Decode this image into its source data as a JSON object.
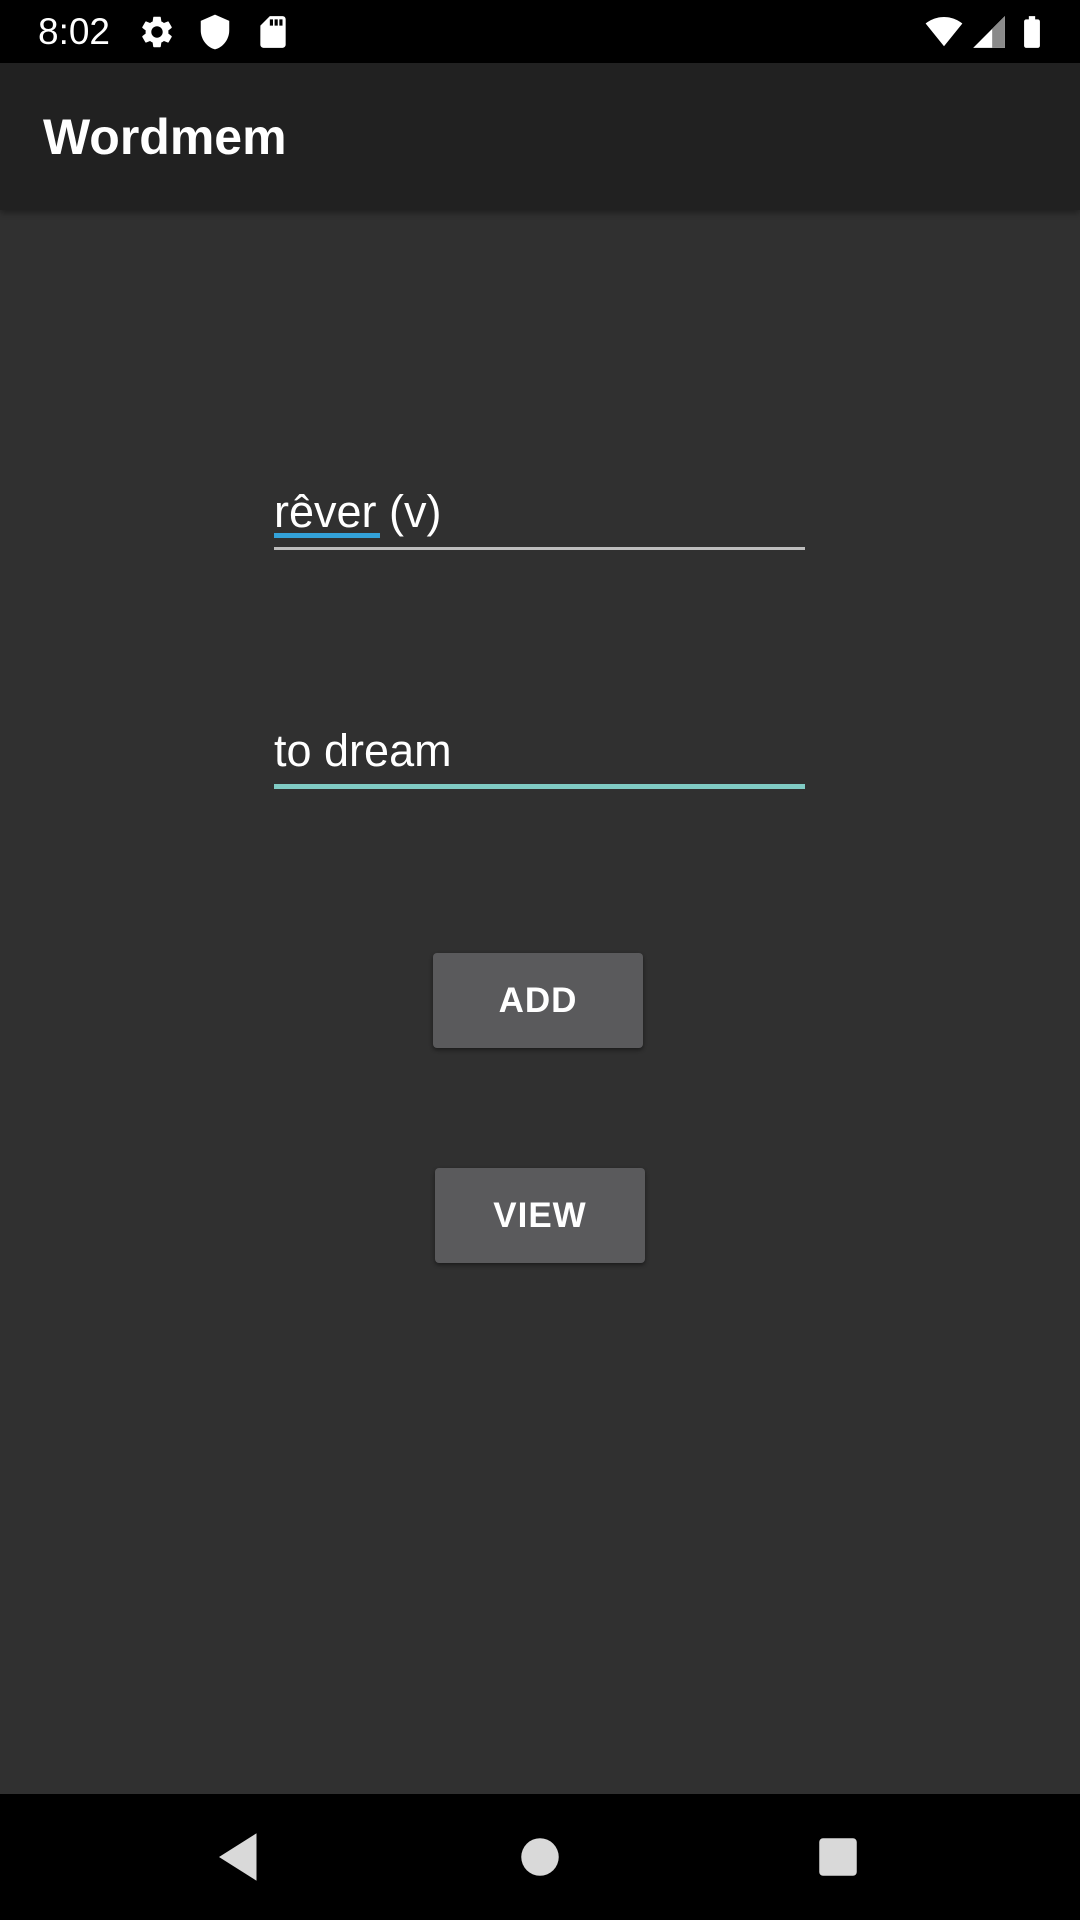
{
  "status_bar": {
    "time": "8:02",
    "left_icons": [
      "settings-icon",
      "shield-icon",
      "sd-card-icon"
    ],
    "right_icons": [
      "wifi-icon",
      "signal-icon",
      "battery-icon"
    ]
  },
  "app_bar": {
    "title": "Wordmem"
  },
  "form": {
    "word_value": "rêver (v)",
    "translation_value": "to dream",
    "add_label": "ADD",
    "view_label": "VIEW"
  },
  "nav_bar": {
    "icons": [
      "back-icon",
      "home-icon",
      "recents-icon"
    ]
  },
  "colors": {
    "background": "#303030",
    "app_bar": "#212121",
    "accent": "#80cbc4",
    "spell_check": "#33a2d9",
    "button": "#5a5a5c"
  }
}
